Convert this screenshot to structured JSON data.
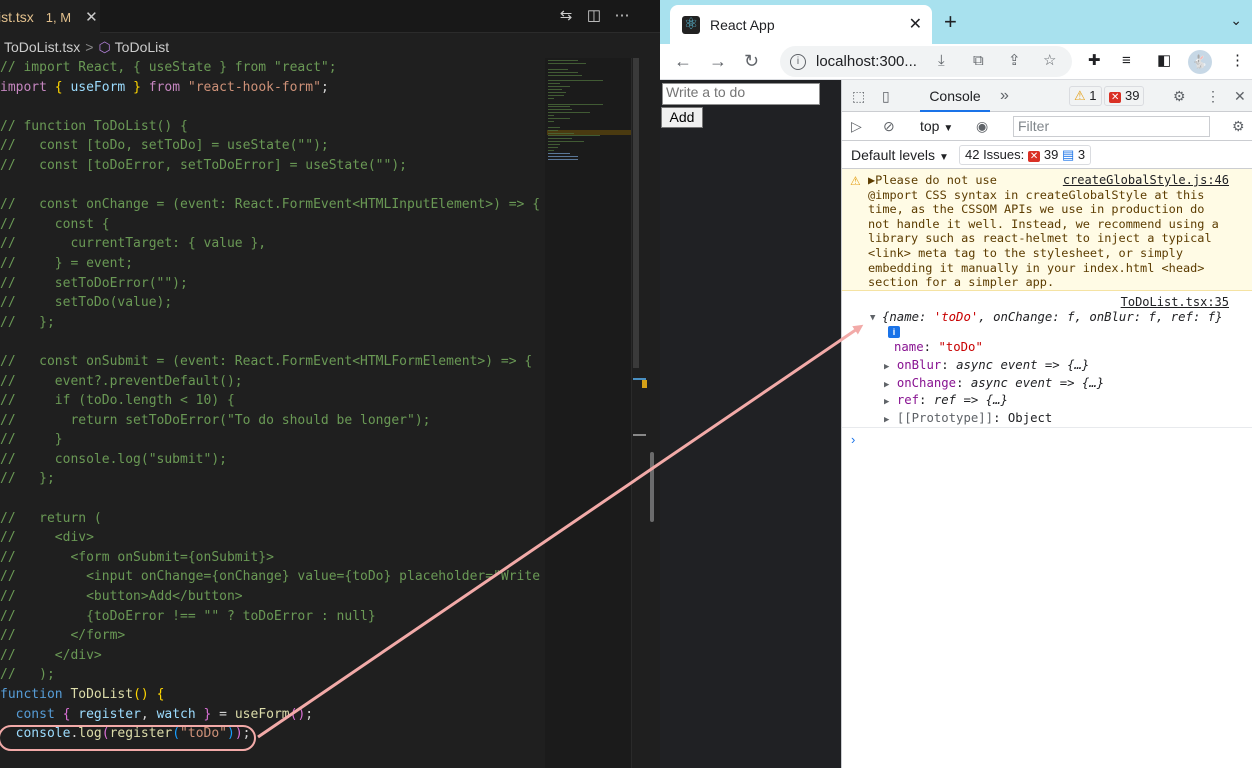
{
  "editor": {
    "tab": {
      "name": "ist.tsx",
      "badge": "1, M",
      "close": "✕"
    },
    "toolbar_icons": [
      "git-compare-icon",
      "split-editor-icon",
      "more-icon"
    ],
    "breadcrumb": {
      "file": "ToDoList.tsx",
      "separator": ">",
      "symbol": "ToDoList"
    },
    "code_lines": [
      {
        "t": [
          [
            "cm",
            "// import React, { useState } from \"react\";"
          ]
        ]
      },
      {
        "t": [
          [
            "kw",
            "import"
          ],
          [
            "pl",
            " "
          ],
          [
            "br1",
            "{"
          ],
          [
            "pl",
            " "
          ],
          [
            "vr",
            "useForm"
          ],
          [
            "pl",
            " "
          ],
          [
            "br1",
            "}"
          ],
          [
            "pl",
            " "
          ],
          [
            "kw",
            "from"
          ],
          [
            "pl",
            " "
          ],
          [
            "st",
            "\"react-hook-form\""
          ],
          [
            "pl",
            ";"
          ]
        ]
      },
      {
        "t": [
          [
            "pl",
            ""
          ]
        ]
      },
      {
        "t": [
          [
            "cm",
            "// function ToDoList() {"
          ]
        ]
      },
      {
        "t": [
          [
            "cm",
            "//   const [toDo, setToDo] = useState(\"\");"
          ]
        ]
      },
      {
        "t": [
          [
            "cm",
            "//   const [toDoError, setToDoError] = useState(\"\");"
          ]
        ]
      },
      {
        "t": [
          [
            "pl",
            ""
          ]
        ]
      },
      {
        "t": [
          [
            "cm",
            "//   const onChange = (event: React.FormEvent<HTMLInputElement>) => {"
          ]
        ]
      },
      {
        "t": [
          [
            "cm",
            "//     const {"
          ]
        ]
      },
      {
        "t": [
          [
            "cm",
            "//       currentTarget: { value },"
          ]
        ]
      },
      {
        "t": [
          [
            "cm",
            "//     } = event;"
          ]
        ]
      },
      {
        "t": [
          [
            "cm",
            "//     setToDoError(\"\");"
          ]
        ]
      },
      {
        "t": [
          [
            "cm",
            "//     setToDo(value);"
          ]
        ]
      },
      {
        "t": [
          [
            "cm",
            "//   };"
          ]
        ]
      },
      {
        "t": [
          [
            "pl",
            ""
          ]
        ]
      },
      {
        "t": [
          [
            "cm",
            "//   const onSubmit = (event: React.FormEvent<HTMLFormElement>) => {"
          ]
        ]
      },
      {
        "t": [
          [
            "cm",
            "//     event?.preventDefault();"
          ]
        ]
      },
      {
        "t": [
          [
            "cm",
            "//     if (toDo.length < 10) {"
          ]
        ]
      },
      {
        "t": [
          [
            "cm",
            "//       return setToDoError(\"To do should be longer\");"
          ]
        ]
      },
      {
        "t": [
          [
            "cm",
            "//     }"
          ]
        ]
      },
      {
        "t": [
          [
            "cm",
            "//     console.log(\"submit\");"
          ]
        ]
      },
      {
        "t": [
          [
            "cm",
            "//   };"
          ]
        ]
      },
      {
        "t": [
          [
            "pl",
            ""
          ]
        ]
      },
      {
        "t": [
          [
            "cm",
            "//   return ("
          ]
        ]
      },
      {
        "t": [
          [
            "cm",
            "//     <div>"
          ]
        ]
      },
      {
        "t": [
          [
            "cm",
            "//       <form onSubmit={onSubmit}>"
          ]
        ]
      },
      {
        "t": [
          [
            "cm",
            "//         <input onChange={onChange} value={toDo} placeholder=\"Write"
          ]
        ]
      },
      {
        "t": [
          [
            "cm",
            "//         <button>Add</button>"
          ]
        ]
      },
      {
        "t": [
          [
            "cm",
            "//         {toDoError !== \"\" ? toDoError : null}"
          ]
        ]
      },
      {
        "t": [
          [
            "cm",
            "//       </form>"
          ]
        ]
      },
      {
        "t": [
          [
            "cm",
            "//     </div>"
          ]
        ]
      },
      {
        "t": [
          [
            "cm",
            "//   );"
          ]
        ]
      },
      {
        "t": [
          [
            "kb",
            "function"
          ],
          [
            "pl",
            " "
          ],
          [
            "fn",
            "ToDoList"
          ],
          [
            "br1",
            "()"
          ],
          [
            "pl",
            " "
          ],
          [
            "br1",
            "{"
          ]
        ]
      },
      {
        "t": [
          [
            "pl",
            "  "
          ],
          [
            "kb",
            "const"
          ],
          [
            "pl",
            " "
          ],
          [
            "br2",
            "{"
          ],
          [
            "pl",
            " "
          ],
          [
            "vr",
            "register"
          ],
          [
            "pl",
            ", "
          ],
          [
            "vr",
            "watch"
          ],
          [
            "pl",
            " "
          ],
          [
            "br2",
            "}"
          ],
          [
            "pl",
            " = "
          ],
          [
            "fn",
            "useForm"
          ],
          [
            "br2",
            "()"
          ],
          [
            "pl",
            ";"
          ]
        ]
      },
      {
        "t": [
          [
            "pl",
            "  "
          ],
          [
            "vr",
            "console"
          ],
          [
            "pl",
            "."
          ],
          [
            "fn",
            "log"
          ],
          [
            "br2",
            "("
          ],
          [
            "fn",
            "register"
          ],
          [
            "br3",
            "("
          ],
          [
            "st",
            "\"toDo\""
          ],
          [
            "br3",
            ")"
          ],
          [
            "br2",
            ")"
          ],
          [
            "pl",
            ";"
          ]
        ]
      }
    ]
  },
  "browser": {
    "tab_title": "React App",
    "tab_close": "✕",
    "new_tab": "+",
    "url": "localhost:300...",
    "nav": {
      "back": "←",
      "forward": "→",
      "reload": "↻"
    },
    "page": {
      "input_placeholder": "Write a to do",
      "add_button": "Add"
    },
    "devtools": {
      "tab_console": "Console",
      "more_tabs": "»",
      "warn_count": "1",
      "error_count": "39",
      "context": "top",
      "filter_placeholder": "Filter",
      "default_levels": "Default levels",
      "issues_label": "42 Issues:",
      "issues_errors": "39",
      "issues_info": "3",
      "warning": {
        "lines": [
          "▶Please do not use",
          "@import CSS syntax in createGlobalStyle at this",
          "time, as the CSSOM APIs we use in production do",
          "not handle it well. Instead, we recommend using a",
          "library such as react-helmet to inject a typical",
          "<link> meta tag to the stylesheet, or simply",
          "embedding it manually in your index.html <head>",
          "section for a simpler app."
        ],
        "source": "createGlobalStyle.js:46"
      },
      "log": {
        "source": "ToDoList.tsx:35",
        "summary_open": "{",
        "summary_k1": "name",
        "summary_v1": "'toDo'",
        "summary_rest": ", onChange: f, onBlur: f, ref: f}",
        "name_key": "name",
        "name_val": "\"toDo\"",
        "onBlur_key": "onBlur",
        "onBlur_val": "async event => {…}",
        "onChange_key": "onChange",
        "onChange_val": "async event => {…}",
        "ref_key": "ref",
        "ref_val": "ref => {…}",
        "proto_key": "[[Prototype]]",
        "proto_val": "Object"
      },
      "prompt": "›"
    }
  },
  "colors": {
    "annotation": "#f2aaa8",
    "accent": "#1a73e8"
  }
}
